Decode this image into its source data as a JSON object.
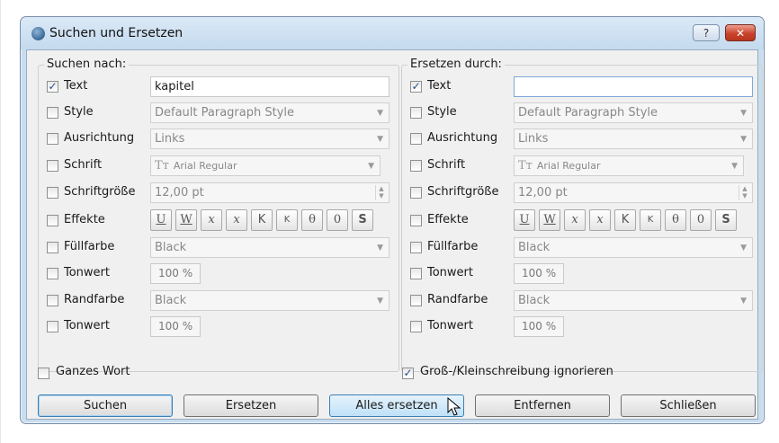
{
  "window": {
    "title": "Suchen und Ersetzen",
    "help_label": "?",
    "close_label": "✕"
  },
  "search": {
    "group_title": "Suchen nach:",
    "rows": [
      {
        "label": "Text",
        "checked": true,
        "value": "kapitel"
      },
      {
        "label": "Style",
        "checked": false,
        "value": "Default Paragraph Style"
      },
      {
        "label": "Ausrichtung",
        "checked": false,
        "value": "Links"
      },
      {
        "label": "Schrift",
        "checked": false,
        "value": "Arial Regular"
      },
      {
        "label": "Schriftgröße",
        "checked": false,
        "value": "12,00 pt"
      },
      {
        "label": "Effekte",
        "checked": false
      },
      {
        "label": "Füllfarbe",
        "checked": false,
        "value": "Black"
      },
      {
        "label": "Tonwert",
        "checked": false,
        "value": "100 %"
      },
      {
        "label": "Randfarbe",
        "checked": false,
        "value": "Black"
      },
      {
        "label": "Tonwert",
        "checked": false,
        "value": "100 %"
      }
    ]
  },
  "replace": {
    "group_title": "Ersetzen durch:",
    "rows": [
      {
        "label": "Text",
        "checked": true,
        "value": ""
      },
      {
        "label": "Style",
        "checked": false,
        "value": "Default Paragraph Style"
      },
      {
        "label": "Ausrichtung",
        "checked": false,
        "value": "Links"
      },
      {
        "label": "Schrift",
        "checked": false,
        "value": "Arial Regular"
      },
      {
        "label": "Schriftgröße",
        "checked": false,
        "value": "12,00 pt"
      },
      {
        "label": "Effekte",
        "checked": false
      },
      {
        "label": "Füllfarbe",
        "checked": false,
        "value": "Black"
      },
      {
        "label": "Tonwert",
        "checked": false,
        "value": "100 %"
      },
      {
        "label": "Randfarbe",
        "checked": false,
        "value": "Black"
      },
      {
        "label": "Tonwert",
        "checked": false,
        "value": "100 %"
      }
    ]
  },
  "effects": [
    "U",
    "W",
    "x",
    "x",
    "K",
    "K",
    "θ",
    "0",
    "S"
  ],
  "options": {
    "whole_word": {
      "label": "Ganzes Wort",
      "checked": false
    },
    "ignore_case": {
      "label": "Groß-/Kleinschreibung ignorieren",
      "checked": true
    }
  },
  "buttons": {
    "search": "Suchen",
    "replace": "Ersetzen",
    "replace_all": "Alles ersetzen",
    "remove": "Entfernen",
    "close": "Schließen"
  },
  "icons": {
    "app": "globe-icon",
    "font": "font-type-icon",
    "cursor": "mouse-pointer-icon"
  },
  "colors": {
    "title_bg": "#c4daee",
    "close_red": "#c9432c",
    "focus_blue": "#3c7fb1"
  }
}
